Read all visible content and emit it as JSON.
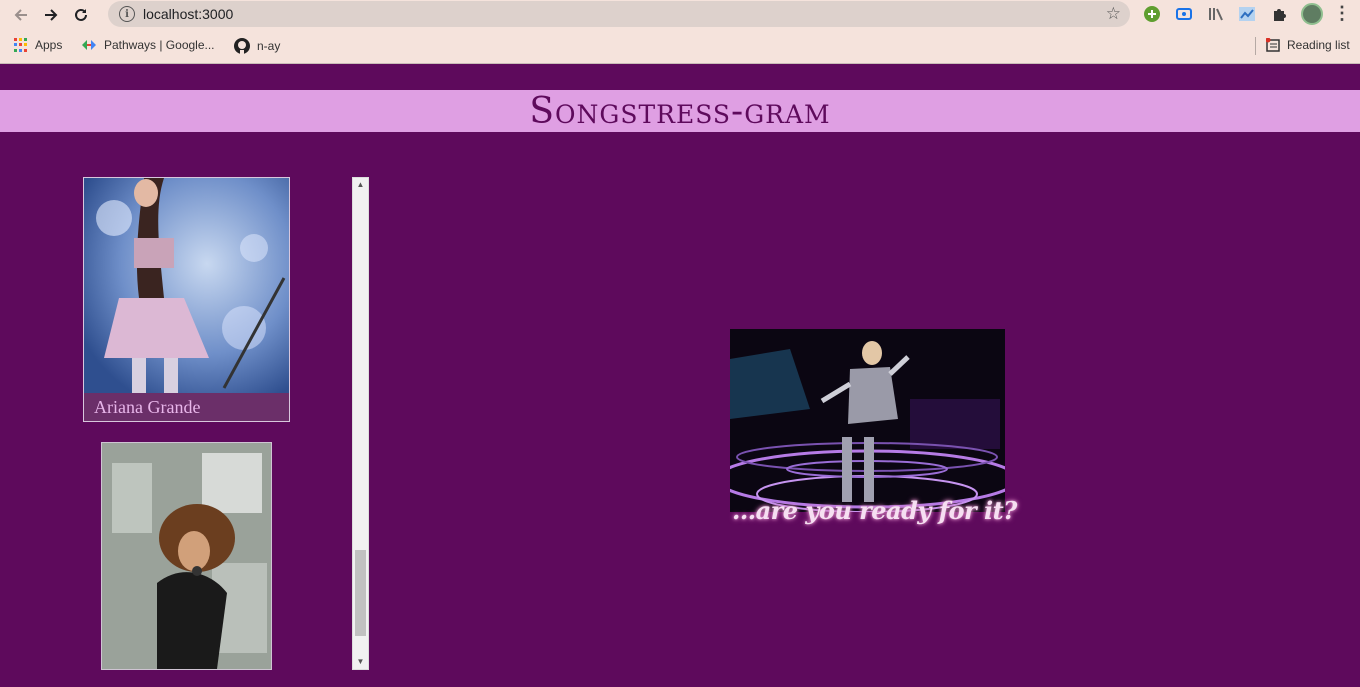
{
  "browser": {
    "url": "localhost:3000",
    "bookmarks": [
      {
        "label": "Apps",
        "icon": "apps-grid-icon"
      },
      {
        "label": "Pathways | Google...",
        "icon": "pathways-icon"
      },
      {
        "label": "n-ay",
        "icon": "github-icon"
      }
    ],
    "reading_list": "Reading list"
  },
  "page": {
    "title": "Songstress-gram",
    "gallery": [
      {
        "name": "Ariana Grande"
      },
      {
        "name": ""
      }
    ],
    "hero_caption": "...are you ready for it?"
  },
  "colors": {
    "page_background": "#5e0a5c",
    "banner_background": "#df9fe3",
    "banner_text": "#5e0a5c",
    "caption_text": "#e8b6ea"
  }
}
